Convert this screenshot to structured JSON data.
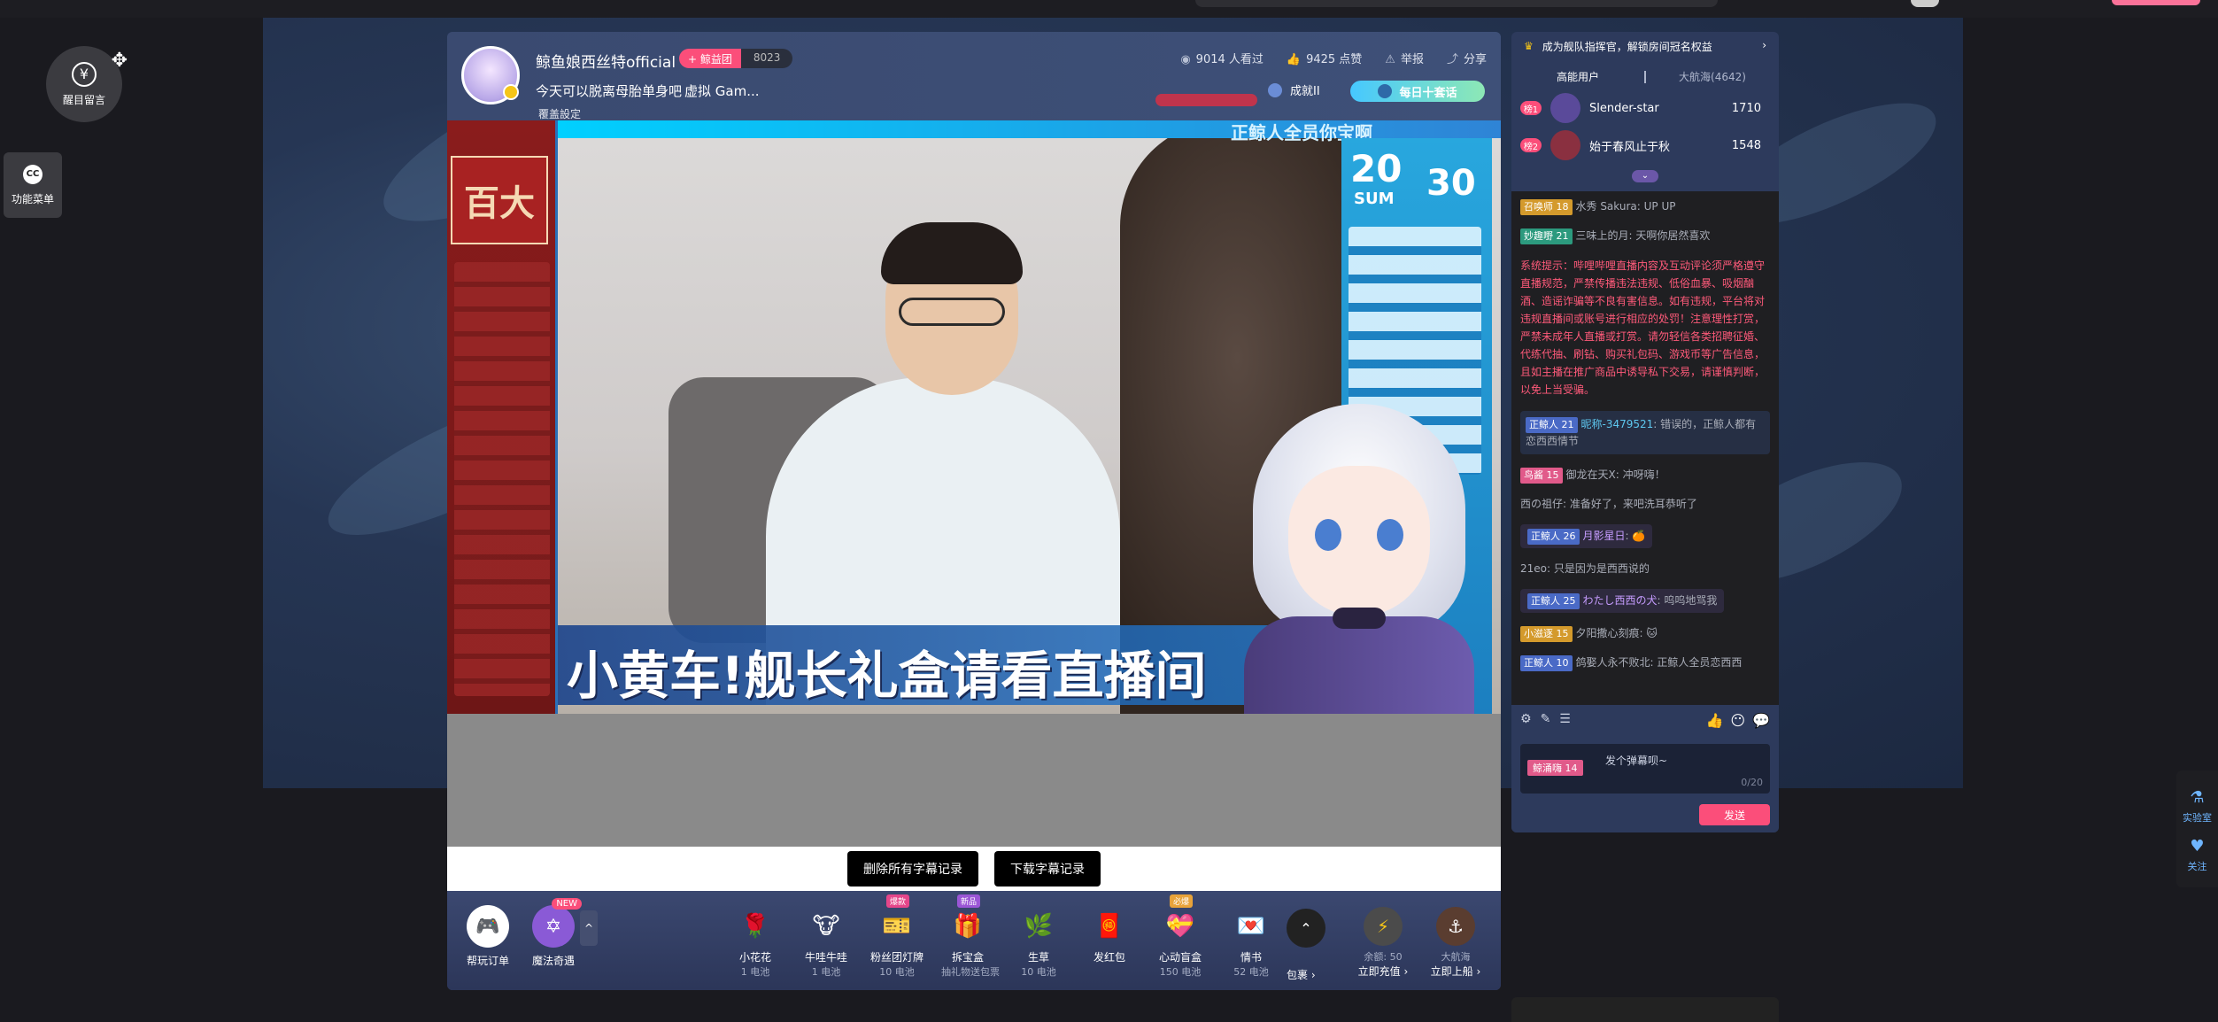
{
  "floating": {
    "bubble_label": "醒目留言",
    "func_menu_label": "功能菜单"
  },
  "header": {
    "streamer_name": "鲸鱼娘西丝特official",
    "fan_club_tag": "+ 鲸益团",
    "fan_club_count": "8023",
    "stream_title": "今天可以脱离母胎单身吧",
    "stream_category": "虚拟 Gam...",
    "settings_link": "覆盖設定",
    "viewers": "9014 人看过",
    "likes": "9425 点赞",
    "report": "举报",
    "share": "分享",
    "rank_chip": "成就II",
    "daily_pill": "每日十套话"
  },
  "video": {
    "left_panel_title": "百大",
    "top_ticker": "正鲸人全员你宝啊",
    "score_left": "20",
    "score_right": "30",
    "score_sum": "SUM",
    "caption": "小黄车!舰长礼盒请看直播间"
  },
  "subtitle": {
    "delete_label": "删除所有字幕记录",
    "download_label": "下载字幕记录"
  },
  "gift_bar": {
    "left_items": [
      {
        "label": "帮玩订单",
        "icon": "controller-icon"
      },
      {
        "label": "魔法奇遇",
        "icon": "magic-circle-icon",
        "badge": "NEW"
      }
    ],
    "gifts": [
      {
        "name": "小花花",
        "price": "1 电池",
        "icon": "🌹",
        "tag": ""
      },
      {
        "name": "牛哇牛哇",
        "price": "1 电池",
        "icon": "🐮",
        "tag": ""
      },
      {
        "name": "粉丝团灯牌",
        "price": "10 电池",
        "icon": "🎫",
        "tag": "爆款"
      },
      {
        "name": "拆宝盒",
        "price": "抽礼物送包票",
        "icon": "🎁",
        "tag": "新品"
      },
      {
        "name": "生草",
        "price": "10 电池",
        "icon": "🌿",
        "tag": ""
      },
      {
        "name": "发红包",
        "price": "",
        "icon": "🧧",
        "tag": ""
      },
      {
        "name": "心动盲盒",
        "price": "150 电池",
        "icon": "💝",
        "tag": "必爆"
      },
      {
        "name": "情书",
        "price": "52 电池",
        "icon": "💌",
        "tag": ""
      }
    ],
    "package_label": "包裹",
    "balance_label": "余额: 50",
    "recharge_label": "立即充值",
    "voyage_label": "大航海",
    "board_label": "立即上船"
  },
  "side": {
    "captain_text": "成为舰队指挥官，解锁房间冠名权益",
    "tab_high": "高能用户",
    "tab_voyage": "大航海(4642)",
    "ranks": [
      {
        "rank": "榜1",
        "name": "Slender-star",
        "score": "1710",
        "color": "#5a4a9a"
      },
      {
        "rank": "榜2",
        "name": "始于春风止于秋",
        "score": "1548",
        "color": "#8a3040"
      }
    ],
    "chat": [
      {
        "lv": "召唤师 18",
        "cls": "gold",
        "user": "水秀 Sakura",
        "msg": ": UP UP"
      },
      {
        "lv": "妙趣嘢 21",
        "cls": "teal",
        "user": "三味上的月",
        "msg": ": 天啊你居然喜欢"
      }
    ],
    "system_notice": "系统提示：哔哩哔哩直播内容及互动评论须严格遵守直播规范，严禁传播违法违规、低俗血暴、吸烟酗酒、造谣诈骗等不良有害信息。如有违规，平台将对违规直播间或账号进行相应的处罚！注意理性打赏，严禁未成年人直播或打赏。请勿轻信各类招聘征婚、代练代抽、刷钻、购买礼包码、游戏币等广告信息，且如主播在推广商品中诱导私下交易，请谨慎判断，以免上当受骗。",
    "chat2": [
      {
        "lv": "正鲸人 21",
        "cls": "blue",
        "user": "昵称-3479521",
        "msg": ": 错误的，正鲸人都有恋西西情节",
        "style": "hl"
      },
      {
        "lv": "鸟酱 15",
        "cls": "pink",
        "user": "御龙在天X",
        "msg": ": 冲呀嗨！",
        "style": ""
      },
      {
        "lv": "",
        "cls": "",
        "user": "西の祖仔",
        "msg": ": 准备好了，来吧洗耳恭听了",
        "style": ""
      },
      {
        "lv": "正鲸人 26",
        "cls": "blue",
        "user": "月影星日",
        "msg": ": 🍊",
        "style": "strip"
      },
      {
        "lv": "",
        "cls": "",
        "user": "21eo",
        "msg": ": 只是因为是西西说的",
        "style": ""
      },
      {
        "lv": "正鲸人 25",
        "cls": "blue",
        "user": "わたし西西の犬",
        "msg": ": 呜呜地骂我",
        "style": "strip"
      },
      {
        "lv": "小滋逐 15",
        "cls": "gold",
        "user": "夕阳撒心刻痕",
        "msg": ": 🐱",
        "style": ""
      },
      {
        "lv": "正鲸人 10",
        "cls": "blue",
        "user": "鸽娶人永不败北",
        "msg": ": 正鲸人全员恋西西",
        "style": ""
      }
    ],
    "input_level": "鲸涌嗨 14",
    "input_placeholder": "发个弹幕呗~",
    "input_count": "0/20",
    "send_label": "发送"
  },
  "dock": {
    "lab_label": "实验室",
    "follow_label": "关注"
  }
}
